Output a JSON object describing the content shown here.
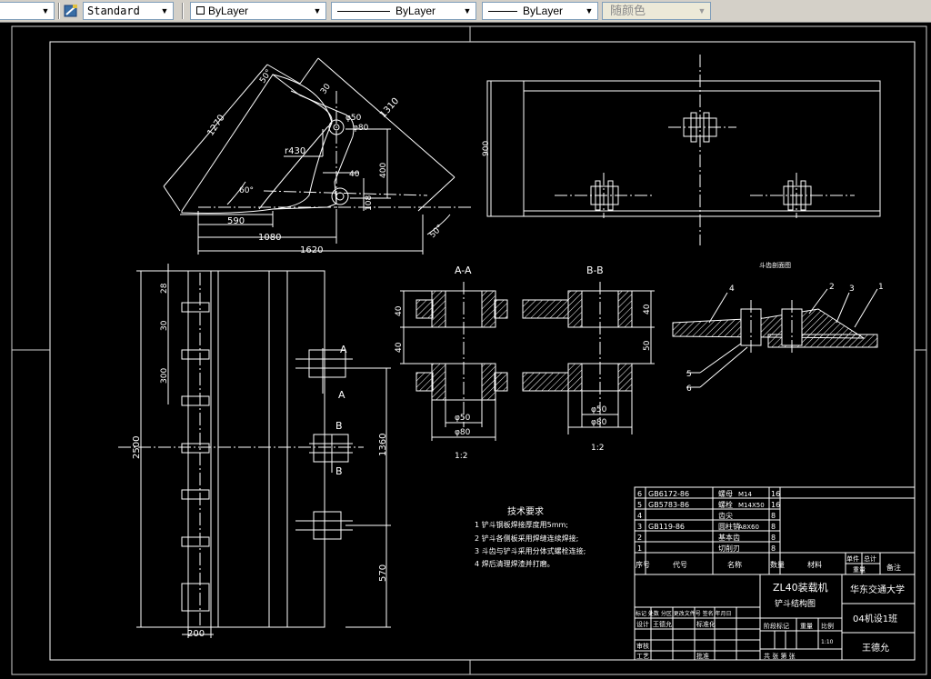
{
  "toolbar": {
    "text_style": "Standard",
    "layer": "ByLayer",
    "linetype": "ByLayer",
    "lineweight": "ByLayer",
    "plot_color": "随颜色"
  },
  "drawing": {
    "dims_side": {
      "d1270": "1270",
      "d30": "30",
      "d50": "φ50",
      "d80": "φ80",
      "d1310": "1310",
      "r430": "r430",
      "d40": "40",
      "d400": "400",
      "d108": "108",
      "a60": "60°",
      "a50": "50°",
      "d590": "590",
      "d1080": "1080",
      "d1620": "1620",
      "a51": "50°"
    },
    "dims_top": {
      "d900": "900"
    },
    "dims_front": {
      "d28": "28",
      "d30": "30",
      "d300": "300",
      "d2500": "2500",
      "d200": "200",
      "d1360": "1360",
      "d570": "570",
      "A1": "A",
      "A2": "A",
      "B1": "B",
      "B2": "B"
    },
    "section_aa": {
      "title": "A-A",
      "d40a": "40",
      "d40b": "40",
      "phi50": "φ50",
      "phi80": "φ80",
      "scale": "1:2"
    },
    "section_bb": {
      "title": "B-B",
      "d40": "40",
      "d50": "50",
      "phi50": "φ50",
      "phi80": "φ80",
      "scale": "1:2"
    },
    "tooth": {
      "title": "斗齿剖面图",
      "n1": "1",
      "n2": "2",
      "n3": "3",
      "n4": "4",
      "n5": "5",
      "n6": "6"
    },
    "tech": {
      "title": "技术要求",
      "lines": [
        "1 铲斗钢板焊接厚度用5mm;",
        "2 铲斗各侧板采用焊缝连续焊接;",
        "3 斗齿与铲斗采用分体式螺栓连接;",
        "4 焊后清理焊渣并打磨。"
      ]
    },
    "bom": [
      {
        "no": "6",
        "code": "GB6172-86",
        "name": "螺母",
        "spec": "M14",
        "qty": "16"
      },
      {
        "no": "5",
        "code": "GB5783-86",
        "name": "螺栓",
        "spec": "M14X50",
        "qty": "16"
      },
      {
        "no": "4",
        "code": "",
        "name": "齿尖",
        "spec": "",
        "qty": "8"
      },
      {
        "no": "3",
        "code": "GB119-86",
        "name": "圆柱销",
        "spec": "A8X60",
        "qty": "8"
      },
      {
        "no": "2",
        "code": "",
        "name": "基本齿",
        "spec": "",
        "qty": "8"
      },
      {
        "no": "1",
        "code": "",
        "name": "切削刃",
        "spec": "",
        "qty": "8"
      }
    ],
    "bom_header": {
      "no": "序号",
      "code": "代号",
      "name": "名称",
      "qty": "数量",
      "material": "材料",
      "single": "单件",
      "total": "总计",
      "weight": "重量",
      "remark": "备注"
    },
    "title_block": {
      "product": "ZL40装载机",
      "part": "铲斗结构图",
      "school": "华东交通大学",
      "class": "04机设1班",
      "author": "王德允",
      "scale": "1:10",
      "row_labels": "标记 处数 分区 更改文件号 签名 年月日",
      "design": "设计",
      "designer": "王德允",
      "standard": "标准化",
      "check": "审核",
      "process": "工艺",
      "approve": "批准",
      "stage": "阶段标记",
      "weight": "重量",
      "ratio": "比例",
      "sheets": "共 张 第 张"
    }
  }
}
